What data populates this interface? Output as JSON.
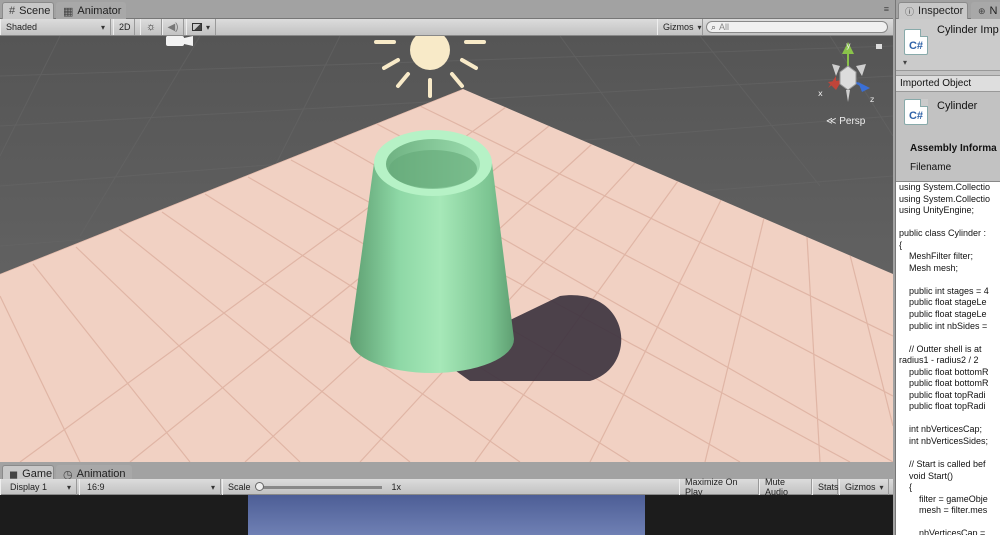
{
  "scene_tabbar": {
    "tabs": [
      {
        "label": "Scene",
        "icon": "grid-icon",
        "active": true
      },
      {
        "label": "Animator",
        "icon": "animator-icon",
        "active": false
      }
    ]
  },
  "scene_toolbar": {
    "shading_mode": "Shaded",
    "mode_2d": "2D",
    "gizmos": "Gizmos",
    "search_placeholder": "All"
  },
  "scene_view": {
    "projection_label": "Persp",
    "axes": {
      "x": "x",
      "y": "y",
      "z": "z"
    },
    "colors": {
      "ground": "#f1d1c3",
      "ground_grid": "#e2b9aa",
      "horizon_bg": "#5e5e5e",
      "cylinder": "#8ed8a6",
      "sun": "#f8eac8",
      "shadow": "#3e3440"
    }
  },
  "game_tabbar": {
    "tabs": [
      {
        "label": "Game",
        "icon": "game-icon",
        "active": true
      },
      {
        "label": "Animation",
        "icon": "clock-icon",
        "active": false
      }
    ]
  },
  "game_toolbar": {
    "display": "Display 1",
    "aspect": "16:9",
    "scale_label": "Scale",
    "scale_value": "1x",
    "maximize_on_play": "Maximize On Play",
    "mute_audio": "Mute Audio",
    "stats": "Stats",
    "gizmos": "Gizmos"
  },
  "inspector": {
    "tab_label": "Inspector",
    "second_tab_initial": "N",
    "object_title": "Cylinder Imp",
    "imported_object_label": "Imported Object",
    "asset_name": "Cylinder",
    "assembly_label": "Assembly Informa",
    "filename_label": "Filename",
    "icon_text": "C#",
    "code_lines": [
      "using System.Collectio",
      "using System.Collectio",
      "using UnityEngine;",
      "",
      "public class Cylinder :",
      "{",
      "    MeshFilter filter;",
      "    Mesh mesh;",
      "",
      "    public int stages = 4",
      "    public float stageLe",
      "    public float stageLe",
      "    public int nbSides =",
      "",
      "    // Outter shell is at",
      "radius1 - radius2 / 2",
      "    public float bottomR",
      "    public float bottomR",
      "    public float topRadi",
      "    public float topRadi",
      "",
      "    int nbVerticesCap;",
      "    int nbVerticesSides;",
      "",
      "    // Start is called bef",
      "    void Start()",
      "    {",
      "        filter = gameObje",
      "        mesh = filter.mes",
      "",
      "        nbVerticesCap ="
    ]
  }
}
